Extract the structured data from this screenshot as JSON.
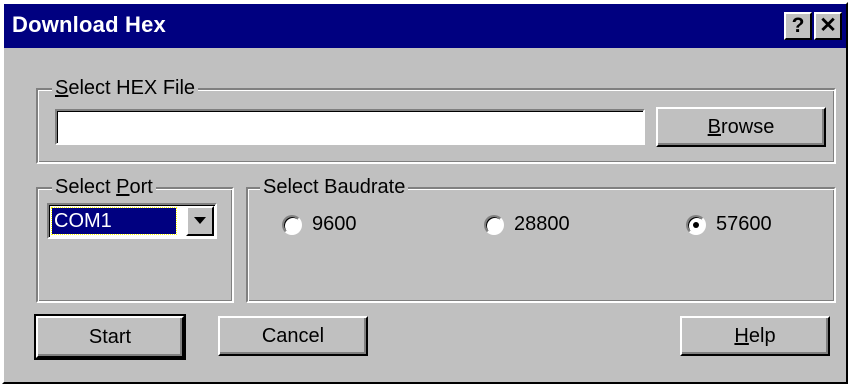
{
  "window": {
    "title": "Download Hex",
    "help_button": "?",
    "close_button": "✕"
  },
  "hex_file": {
    "group_label_prefix": "",
    "group_label_accel": "S",
    "group_label_rest": "elect HEX File",
    "path_value": "",
    "browse_accel": "B",
    "browse_rest": "rowse"
  },
  "port": {
    "group_label_prefix": "Select ",
    "group_label_accel": "P",
    "group_label_rest": "ort",
    "selected": "COM1"
  },
  "baudrate": {
    "group_label": "Select Baudrate",
    "options": [
      {
        "label": "9600",
        "checked": false
      },
      {
        "label": "28800",
        "checked": false
      },
      {
        "label": "57600",
        "checked": true
      }
    ]
  },
  "buttons": {
    "start": "Start",
    "cancel": "Cancel",
    "help_accel": "H",
    "help_rest": "elp"
  },
  "colors": {
    "titlebar": "#000080",
    "face": "#c0c0c0"
  }
}
